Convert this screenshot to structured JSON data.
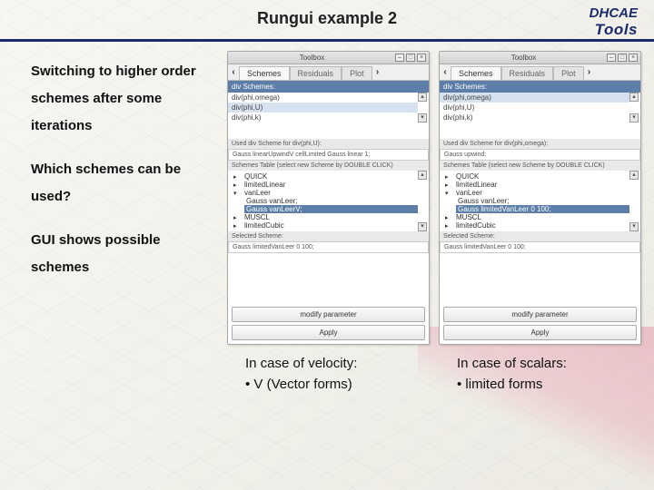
{
  "header": {
    "title": "Rungui example 2",
    "logo_line1": "DHCAE",
    "logo_line2": "Tools"
  },
  "left": {
    "p1a": "Switching to higher order",
    "p1b": "schemes after some",
    "p1c": "iterations",
    "p2a": "Which schemes can be",
    "p2b": "used?",
    "p3a": "GUI shows possible",
    "p3b": "schemes"
  },
  "winA": {
    "title": "Toolbox",
    "tabs": {
      "active": "Schemes",
      "t2": "Residuals",
      "t3": "Plot"
    },
    "divlist_header": "div Schemes:",
    "divlist": [
      "div(phi,omega)",
      "div(phi,U)",
      "div(phi,k)"
    ],
    "div_selected_idx": 1,
    "used": "Used div Scheme for  div(phi,U):",
    "usedline": "Gauss linearUpwindV cellLimited Gauss linear 1;",
    "tablehdr": "Schemes Table (select new Scheme by DOUBLE CLICK)",
    "schemes": [
      {
        "open": false,
        "name": "QUICK"
      },
      {
        "open": false,
        "name": "limitedLinear"
      },
      {
        "open": true,
        "name": "vanLeer",
        "children": [
          {
            "txt": "Gauss vanLeer;",
            "hl": false
          },
          {
            "txt": "Gauss vanLeerV;",
            "hl": true
          }
        ]
      },
      {
        "open": false,
        "name": "MUSCL"
      },
      {
        "open": false,
        "name": "limitedCubic"
      }
    ],
    "selected_label": "Selected Scheme:",
    "selected_val": "Gauss limitedVanLeer 0   100;",
    "btn_modify": "modify parameter",
    "btn_apply": "Apply",
    "caption1": "In case of velocity:",
    "caption2": "• V (Vector forms)"
  },
  "winB": {
    "title": "Toolbox",
    "tabs": {
      "active": "Schemes",
      "t2": "Residuals",
      "t3": "Plot"
    },
    "divlist_header": "div Schemes:",
    "divlist": [
      "div(phi,omega)",
      "div(phi,U)",
      "div(phi,k)"
    ],
    "div_selected_idx": 0,
    "used": "Used div Scheme for  div(phi,omega):",
    "usedline": "Gauss upwind;",
    "tablehdr": "Schemes Table (select new Scheme by DOUBLE CLICK)",
    "schemes": [
      {
        "open": false,
        "name": "QUICK"
      },
      {
        "open": false,
        "name": "limitedLinear"
      },
      {
        "open": true,
        "name": "vanLeer",
        "children": [
          {
            "txt": "Gauss vanLeer;",
            "hl": false
          },
          {
            "txt": "Gauss limitedVanLeer 0   100;",
            "hl": true
          }
        ]
      },
      {
        "open": false,
        "name": "MUSCL"
      },
      {
        "open": false,
        "name": "limitedCubic"
      }
    ],
    "selected_label": "Selected Scheme:",
    "selected_val": "Gauss limitedVanLeer 0   100;",
    "btn_modify": "modify parameter",
    "btn_apply": "Apply",
    "caption1": "In case of scalars:",
    "caption2": "• limited forms"
  }
}
